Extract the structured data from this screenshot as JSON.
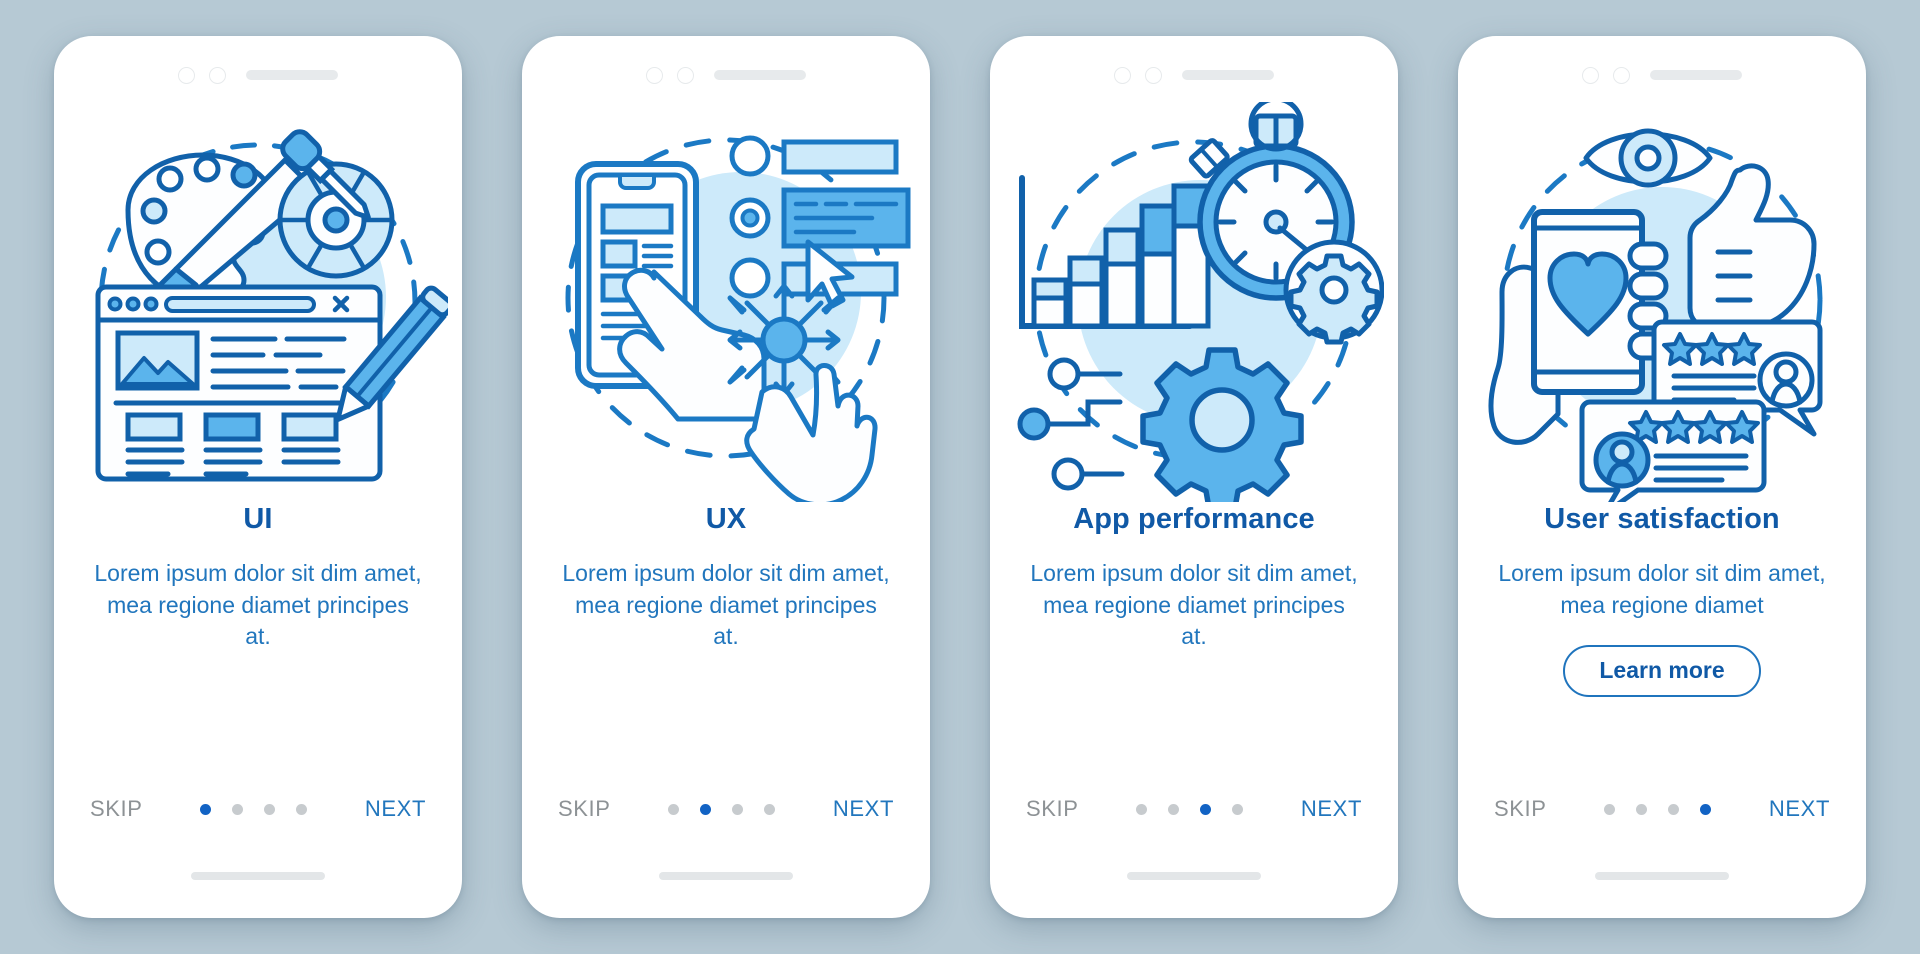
{
  "theme": {
    "page_background": "#b6c9d4",
    "card_background": "#ffffff",
    "title_color": "#1059a6",
    "body_color": "#2176bd",
    "accent_blue": "#1263c4",
    "line_blue": "#1b79c4",
    "fill_light": "#cdeafa",
    "fill_mid": "#5bb4ec",
    "inactive_dot": "#c7cbce",
    "skip_color": "#8d9295"
  },
  "screens": [
    {
      "id": "ui",
      "illustration": "ui-design-illustration",
      "title": "UI",
      "description": "Lorem ipsum dolor sit dim amet, mea regione diamet principes at.",
      "has_learn_more": false,
      "learn_more_label": "",
      "skip_label": "SKIP",
      "next_label": "NEXT",
      "dots": 4,
      "active_dot": 1
    },
    {
      "id": "ux",
      "illustration": "ux-interaction-illustration",
      "title": "UX",
      "description": "Lorem ipsum dolor sit dim amet, mea regione diamet principes at.",
      "has_learn_more": false,
      "learn_more_label": "",
      "skip_label": "SKIP",
      "next_label": "NEXT",
      "dots": 4,
      "active_dot": 2
    },
    {
      "id": "app-performance",
      "illustration": "app-performance-illustration",
      "title": "App performance",
      "description": "Lorem ipsum dolor sit dim amet, mea regione diamet principes at.",
      "has_learn_more": false,
      "learn_more_label": "",
      "skip_label": "SKIP",
      "next_label": "NEXT",
      "dots": 4,
      "active_dot": 3
    },
    {
      "id": "user-satisfaction",
      "illustration": "user-satisfaction-illustration",
      "title": "User satisfaction",
      "description": "Lorem ipsum dolor sit dim amet, mea regione diamet",
      "has_learn_more": true,
      "learn_more_label": "Learn more",
      "skip_label": "SKIP",
      "next_label": "NEXT",
      "dots": 4,
      "active_dot": 4
    }
  ]
}
